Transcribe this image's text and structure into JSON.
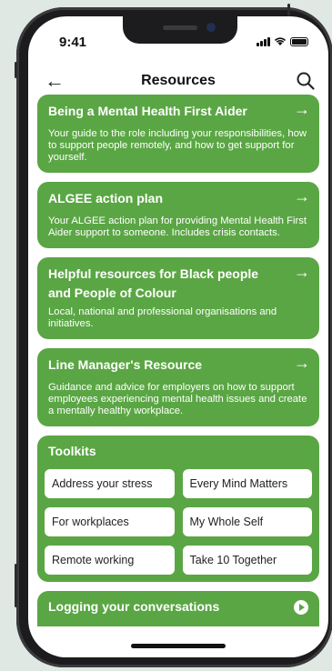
{
  "status": {
    "time": "9:41"
  },
  "header": {
    "title": "Resources"
  },
  "cards": [
    {
      "title": "Being a Mental Health First Aider",
      "desc": "Your guide to the role including your responsibilities, how to support people remotely, and how to get support for yourself."
    },
    {
      "title": "ALGEE action plan",
      "desc": "Your ALGEE action plan for providing Mental Health First Aider support to someone. Includes crisis contacts."
    },
    {
      "title": "Helpful resources for Black people and People of Colour",
      "desc": "Local, national and professional organisations and initiatives."
    },
    {
      "title": "Line Manager's Resource",
      "desc": "Guidance and advice for employers on how to support employees experiencing mental health issues and create a mentally healthy workplace."
    }
  ],
  "toolkits": {
    "title": "Toolkits",
    "items": [
      "Address your stress",
      "Every Mind Matters",
      "For workplaces",
      "My Whole Self",
      "Remote working",
      "Take 10 Together"
    ]
  },
  "logging": {
    "title": "Logging your conversations"
  },
  "colors": {
    "accent": "#5aa644",
    "background": "#dfe8e3"
  }
}
